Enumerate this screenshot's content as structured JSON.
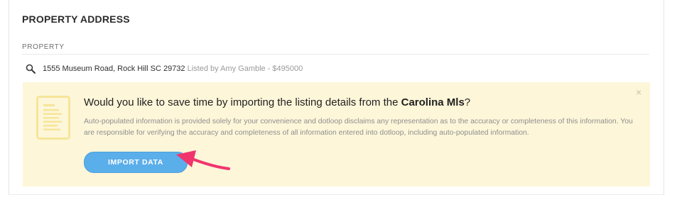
{
  "section": {
    "title": "PROPERTY ADDRESS"
  },
  "property_field": {
    "label": "PROPERTY",
    "address": "1555 Museum Road, Rock Hill SC 29732",
    "listing_info": "Listed by Amy Gamble - $495000"
  },
  "import_banner": {
    "heading_prefix": "Would you like to save time by importing the listing details from the",
    "heading_source": "Carolina Mls",
    "heading_suffix": "?",
    "body": "Auto-populated information is provided solely for your convenience and dotloop disclaims any representation as to the accuracy or completeness of this information. You are responsible for verifying the accuracy and completeness of all information entered into dotloop, including auto-populated information.",
    "button_label": "IMPORT DATA",
    "close_glyph": "×"
  },
  "colors": {
    "banner_bg": "#fdf6d9",
    "button_bg": "#5aaeea",
    "arrow": "#f0356d",
    "doc_icon": "#f6e59a"
  },
  "icons": [
    "search-icon",
    "document-icon",
    "close-icon",
    "pointer-arrow-icon"
  ]
}
